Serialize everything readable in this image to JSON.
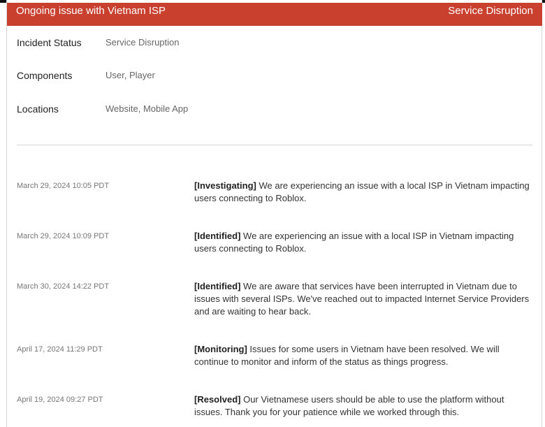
{
  "incident": {
    "title": "Ongoing issue with Vietnam ISP",
    "status_badge": "Service Disruption"
  },
  "details": [
    {
      "label": "Incident Status",
      "value": "Service Disruption"
    },
    {
      "label": "Components",
      "value": "User, Player"
    },
    {
      "label": "Locations",
      "value": "Website, Mobile App"
    }
  ],
  "updates": [
    {
      "timestamp": "March 29, 2024 10:05 PDT",
      "tag": "[Investigating]",
      "text": " We are experiencing an issue with a local ISP in Vietnam impacting users connecting to Roblox."
    },
    {
      "timestamp": "March 29, 2024 10:09 PDT",
      "tag": "[Identified]",
      "text": " We are experiencing an issue with a local ISP in Vietnam impacting users connecting to Roblox."
    },
    {
      "timestamp": "March 30, 2024 14:22 PDT",
      "tag": "[Identified]",
      "text": " We are aware that services have been interrupted in Vietnam due to issues with several ISPs. We've reached out to impacted Internet Service Providers and are waiting to hear back."
    },
    {
      "timestamp": "April 17, 2024 11:29 PDT",
      "tag": "[Monitoring]",
      "text": " Issues for some users in Vietnam have been resolved. We will continue to monitor and inform of the status as things progress."
    },
    {
      "timestamp": "April 19, 2024 09:27 PDT",
      "tag": "[Resolved]",
      "text": " Our Vietnamese users should be able to use the platform without issues. Thank you for your patience while we worked through this."
    }
  ],
  "colors": {
    "header_bg": "#c9402f",
    "header_text": "#ffffff"
  }
}
